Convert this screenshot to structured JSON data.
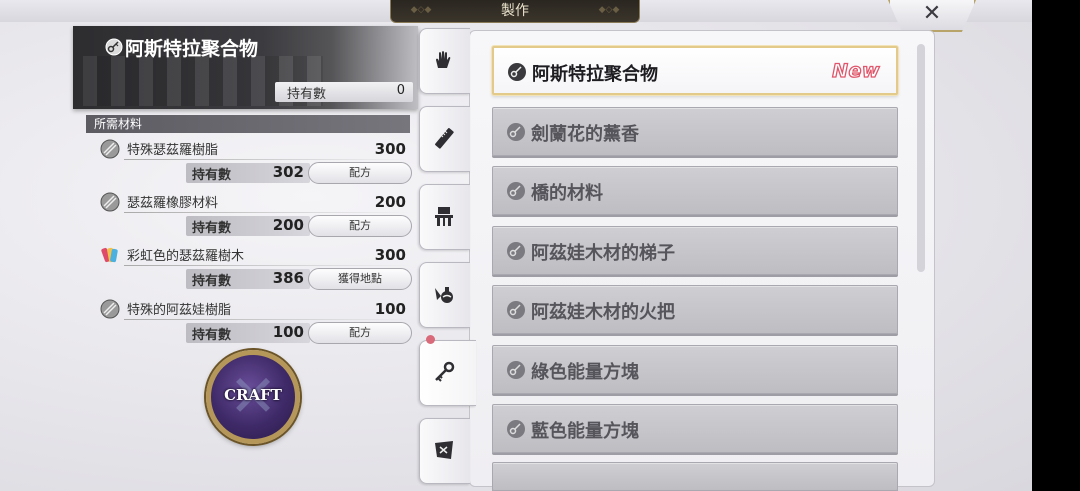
{
  "header": {
    "title": "製作",
    "close_icon": "close-icon"
  },
  "item": {
    "name": "阿斯特拉聚合物",
    "owned_label": "持有數",
    "owned_value": "0",
    "icon": "key-icon"
  },
  "materials": {
    "section_label": "所需材料",
    "items": [
      {
        "name": "特殊瑟茲羅樹脂",
        "required": "300",
        "owned_label": "持有數",
        "owned": "302",
        "action": "配方",
        "icon": "resin-icon"
      },
      {
        "name": "瑟茲羅橡膠材料",
        "required": "200",
        "owned_label": "持有數",
        "owned": "200",
        "action": "配方",
        "icon": "resin-icon"
      },
      {
        "name": "彩虹色的瑟茲羅樹木",
        "required": "300",
        "owned_label": "持有數",
        "owned": "386",
        "action": "獲得地點",
        "icon": "rainbow-wood-icon"
      },
      {
        "name": "特殊的阿茲娃樹脂",
        "required": "100",
        "owned_label": "持有數",
        "owned": "100",
        "action": "配方",
        "icon": "resin-icon"
      }
    ]
  },
  "craft_button": {
    "label": "CRAFT"
  },
  "tabs": [
    {
      "icon": "hand-icon",
      "active": false
    },
    {
      "icon": "ruler-icon",
      "active": false
    },
    {
      "icon": "chair-icon",
      "active": false
    },
    {
      "icon": "bottle-icon",
      "active": false
    },
    {
      "icon": "key-icon",
      "active": true,
      "badge": true
    },
    {
      "icon": "map-icon",
      "active": false
    }
  ],
  "recipes": [
    {
      "name": "阿斯特拉聚合物",
      "selected": true,
      "new_label": "New"
    },
    {
      "name": "劍蘭花的薰香",
      "selected": false
    },
    {
      "name": "橋的材料",
      "selected": false
    },
    {
      "name": "阿茲娃木材的梯子",
      "selected": false
    },
    {
      "name": "阿茲娃木材的火把",
      "selected": false
    },
    {
      "name": "綠色能量方塊",
      "selected": false
    },
    {
      "name": "藍色能量方塊",
      "selected": false
    }
  ],
  "colors": {
    "new_badge": "#e0556a",
    "selected_border": "#e3c98a",
    "craft_purple": "#3f2a68"
  }
}
